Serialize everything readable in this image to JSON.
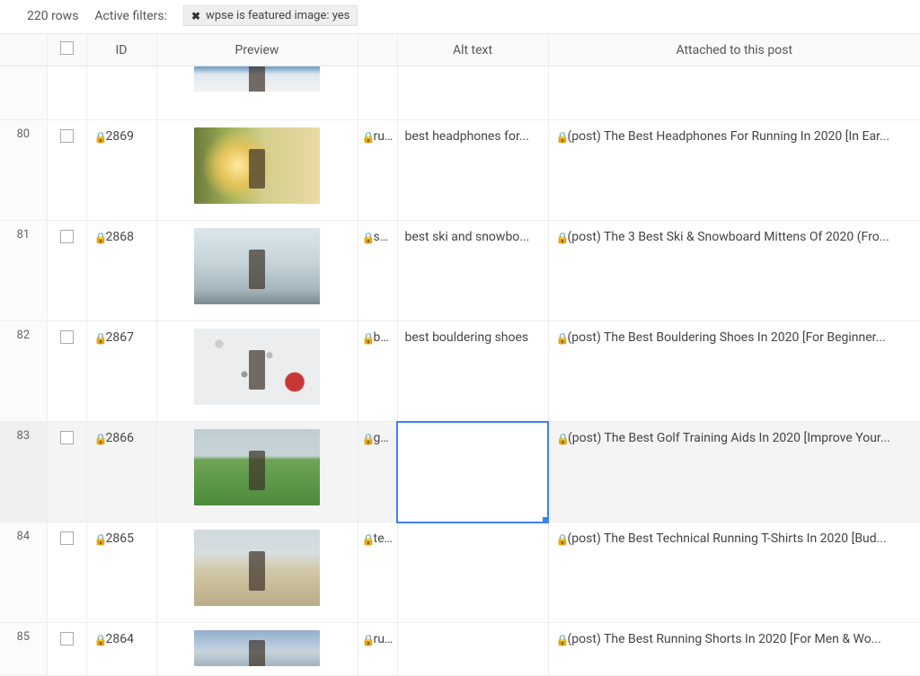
{
  "topbar": {
    "row_count": "220 rows",
    "filters_label": "Active filters:",
    "filter_text": "wpse is featured image: yes"
  },
  "headers": {
    "id": "ID",
    "preview": "Preview",
    "alt": "Alt text",
    "attached": "Attached to this post"
  },
  "rows": [
    {
      "num": "",
      "id": "",
      "fname": "",
      "alt": "",
      "attached": "",
      "thumb": "thumb-mtn",
      "partial": "top"
    },
    {
      "num": "80",
      "id": "2869",
      "fname": "run...",
      "alt": "best headphones for...",
      "attached": "(post) The Best Headphones For Running In 2020 [In Ear...",
      "thumb": "thumb-run"
    },
    {
      "num": "81",
      "id": "2868",
      "fname": "sn...",
      "alt": "best ski and snowbo...",
      "attached": "(post) The 3 Best Ski & Snowboard Mittens Of 2020 (Fro...",
      "thumb": "thumb-snow"
    },
    {
      "num": "82",
      "id": "2867",
      "fname": "bo...",
      "alt": "best bouldering shoes",
      "attached": "(post) The Best Bouldering Shoes In 2020 [For Beginner...",
      "thumb": "thumb-bldr"
    },
    {
      "num": "83",
      "id": "2866",
      "fname": "gol...",
      "alt": "",
      "attached": "(post) The Best Golf Training Aids In 2020 [Improve Your...",
      "thumb": "thumb-golf",
      "selected": true,
      "editing_alt": true
    },
    {
      "num": "84",
      "id": "2865",
      "fname": "tec...",
      "alt": "",
      "attached": "(post) The Best Technical Running T-Shirts In 2020 [Bud...",
      "thumb": "thumb-tech"
    },
    {
      "num": "85",
      "id": "2864",
      "fname": "run...",
      "alt": "",
      "attached": "(post) The Best Running Shorts In 2020 [For Men & Wo...",
      "thumb": "thumb-run2",
      "partial": "bottom"
    }
  ]
}
